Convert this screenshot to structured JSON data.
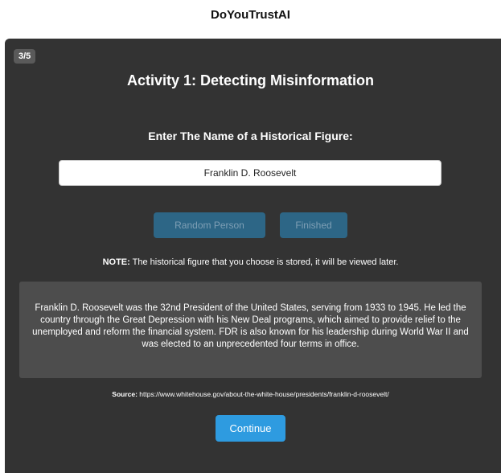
{
  "app": {
    "title": "DoYouTrustAI"
  },
  "activity": {
    "step": "3/5",
    "title": "Activity 1: Detecting Misinformation",
    "prompt": "Enter The Name of a Historical Figure:",
    "input_value": "Franklin D. Roosevelt",
    "random_button": "Random Person",
    "finished_button": "Finished",
    "note_label": "NOTE:",
    "note_text": " The historical figure that you choose is stored, it will be viewed later.",
    "bio": "Franklin D. Roosevelt was the 32nd President of the United States, serving from 1933 to 1945. He led the country through the Great Depression with his New Deal programs, which aimed to provide relief to the unemployed and reform the financial system. FDR is also known for his leadership during World War II and was elected to an unprecedented four terms in office.",
    "source_label": "Source:",
    "source_url": " https://www.whitehouse.gov/about-the-white-house/presidents/franklin-d-roosevelt/",
    "continue_button": "Continue"
  },
  "colors": {
    "panel_bg": "#333333",
    "bio_bg": "#4d4d4d",
    "muted_button": "#2d6686",
    "accent": "#2e9be0"
  }
}
